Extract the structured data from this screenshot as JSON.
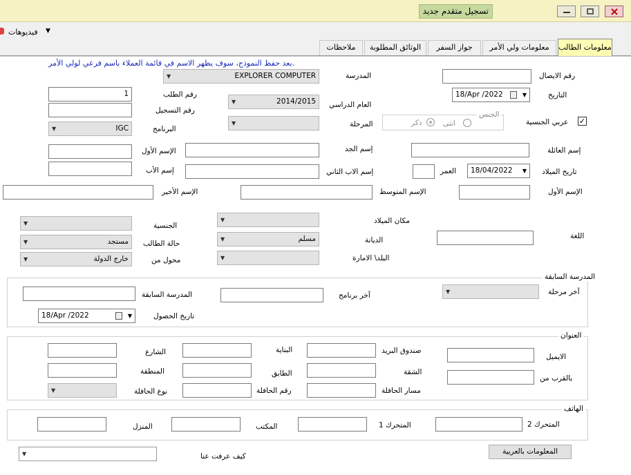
{
  "window": {
    "title": "تسجيل متقدم جديد"
  },
  "menubar": {
    "videos": "فيديوهات"
  },
  "tabs": [
    "معلومات الطالب",
    "معلومات ولي الأمر",
    "جواز السفر",
    "الوثائق المطلوبة",
    "ملاحظات"
  ],
  "notice": "بعد حفظ النموذج، سوف يظهر الاسم في قائمة العملاء باسم فرعي لولي الأمر.",
  "labels": {
    "receipt_no": "رقم الايصال",
    "school": "المدرسة",
    "date": "التاريخ",
    "request_no": "رقم الطلب",
    "registration_no": "رقم التسجيل",
    "program": "البرنامج",
    "academic_year": "العام الدراسي",
    "stage": "المرحلة",
    "gender": "الجنس",
    "male": "ذكر",
    "female": "انثى",
    "arab_nationality": "عربي الجنسية",
    "family_name": "إسم العائلة",
    "grandfather_name": "إسم الجد",
    "first_name_ar": "الإسم الأول",
    "birth_date": "تاريخ الميلاد",
    "age": "العمر",
    "second_father_name": "إسم الاب الثاني",
    "father_name": "إسم الأب",
    "first_name": "الإسم الأول",
    "middle_name": "الإسم المتوسط",
    "last_name": "الإسم الأخير",
    "language": "اللغة",
    "birth_place": "مكان الميلاد",
    "nationality": "الجنسية",
    "religion": "الديانة",
    "student_status": "حالة الطالب",
    "country_emirate": "البلد\\ الامارة",
    "transferred_from": "محول من",
    "previous_school_group": "المدرسة السابقة",
    "last_stage": "آخر مرحلة",
    "last_program": "آخر برنامج",
    "previous_school": "المدرسة السابقة",
    "obtained_date": "تاريخ الحصول",
    "address_group": "العنوان",
    "email": "الايميل",
    "po_box": "صندوق البريد",
    "building": "البناية",
    "street": "الشارع",
    "nearby": "بالقرب من",
    "apartment": "الشقة",
    "floor": "الطابق",
    "area": "المنطقة",
    "bus_route": "مسار الحافلة",
    "bus_no": "رقم الحافلة",
    "bus_type": "نوع الحافلة",
    "phone_group": "الهاتف",
    "mobile2": "المتحرك 2",
    "mobile1": "المتحرك 1",
    "office": "المكتب",
    "home": "المنزل",
    "how_know": "كيف عرفت عنا"
  },
  "values": {
    "school": "EXPLORER COMPUTER",
    "date": "18/Apr /2022",
    "request_no": "1",
    "academic_year": "2014/2015",
    "program": "IGC",
    "birth_date": "18/04/2022",
    "religion": "مسلم",
    "student_status": "مستجد",
    "transferred_from": "خارج الدولة",
    "obtained_date": "18/Apr /2022",
    "arab_nationality_checked": "✓"
  },
  "buttons": {
    "arabic_info": "المعلومات بالعربية"
  },
  "colors": {
    "titlebar": "#f7f2c4",
    "title_badge": "#c5d89e",
    "active_tab": "#fffdb4",
    "notice": "#1a2ab8"
  }
}
